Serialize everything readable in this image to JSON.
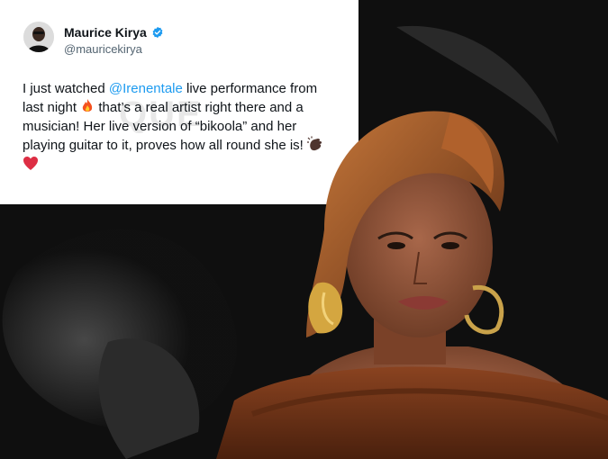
{
  "tweet": {
    "author_name": "Maurice Kirya",
    "author_handle": "@mauricekirya",
    "text_part1": "I just watched ",
    "mention": "@Irenentale",
    "text_part2": " live performance from last night ",
    "text_part3": " that’s a real artist right there and a musician! Her live version of “bikoola” and her playing guitar to it, proves how all round she is! "
  },
  "icons": {
    "verified": "verified-badge-icon",
    "fire": "fire-emoji",
    "clap": "clapping-hands-emoji",
    "heart": "red-heart-emoji"
  },
  "colors": {
    "mention": "#1d9bf0",
    "verified": "#1d9bf0",
    "background": "#0d0d0d",
    "dress": "#8a4320"
  }
}
